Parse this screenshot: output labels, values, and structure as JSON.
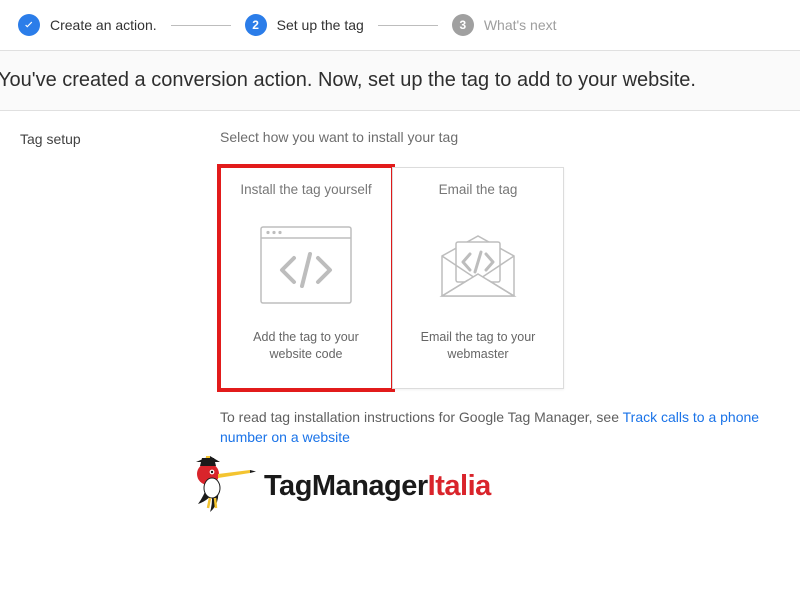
{
  "stepper": {
    "step1": {
      "label": "Create an action."
    },
    "step2": {
      "number": "2",
      "label": "Set up the tag"
    },
    "step3": {
      "number": "3",
      "label": "What's next"
    }
  },
  "header": {
    "title": "You've created a conversion action. Now, set up the tag to add to your website."
  },
  "section": {
    "label": "Tag setup",
    "subtitle": "Select how you want to install your tag"
  },
  "cards": {
    "install": {
      "title": "Install the tag yourself",
      "desc": "Add the tag to your website code"
    },
    "email": {
      "title": "Email the tag",
      "desc": "Email the tag to your webmaster"
    }
  },
  "instructions": {
    "prefix": "To read tag installation instructions for Google Tag Manager, see ",
    "link": "Track calls to a phone number on a website"
  },
  "logo": {
    "text_black": "TagManager",
    "text_red": "Italia"
  }
}
